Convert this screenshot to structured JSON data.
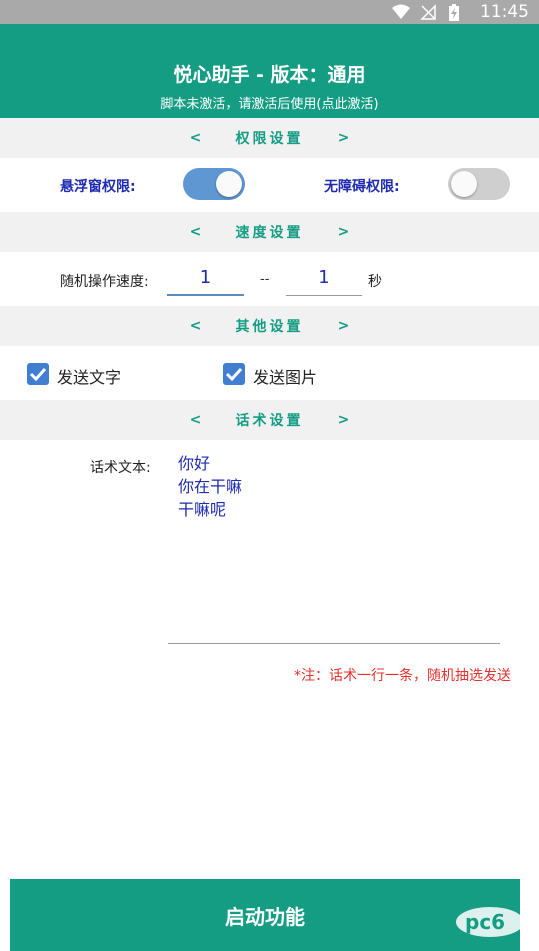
{
  "status_bar": {
    "time": "11:45"
  },
  "header": {
    "title": "悦心助手 - 版本：通用",
    "subtitle": "脚本未激活，请激活后使用(点此激活)"
  },
  "sections": {
    "permissions": {
      "label": "权限设置",
      "prev": "<",
      "next": ">"
    },
    "speed": {
      "label": "速度设置",
      "prev": "<",
      "next": ">"
    },
    "other": {
      "label": "其他设置",
      "prev": "<",
      "next": ">"
    },
    "talk": {
      "label": "话术设置",
      "prev": "<",
      "next": ">"
    }
  },
  "permissions": {
    "float_window": {
      "label": "悬浮窗权限:",
      "enabled": true
    },
    "accessibility": {
      "label": "无障碍权限:",
      "enabled": false
    }
  },
  "speed": {
    "label": "随机操作速度:",
    "min": "1",
    "separator": "--",
    "max": "1",
    "unit": "秒"
  },
  "other": {
    "send_text": {
      "label": "发送文字",
      "checked": true
    },
    "send_image": {
      "label": "发送图片",
      "checked": true
    }
  },
  "talk": {
    "label": "话术文本:",
    "text": "你好\n你在干嘛\n干嘛呢",
    "note": "*注：话术一行一条，随机抽选发送"
  },
  "start_button": {
    "label": "启动功能"
  },
  "colors": {
    "primary": "#159d84",
    "toggle_on": "#5f97d3",
    "toggle_off": "#cfcfcf",
    "label_blue": "#1f2bb0",
    "note_red": "#e5312c",
    "section_bg": "#f1f1f1",
    "status_bar": "#a9a9a9"
  }
}
